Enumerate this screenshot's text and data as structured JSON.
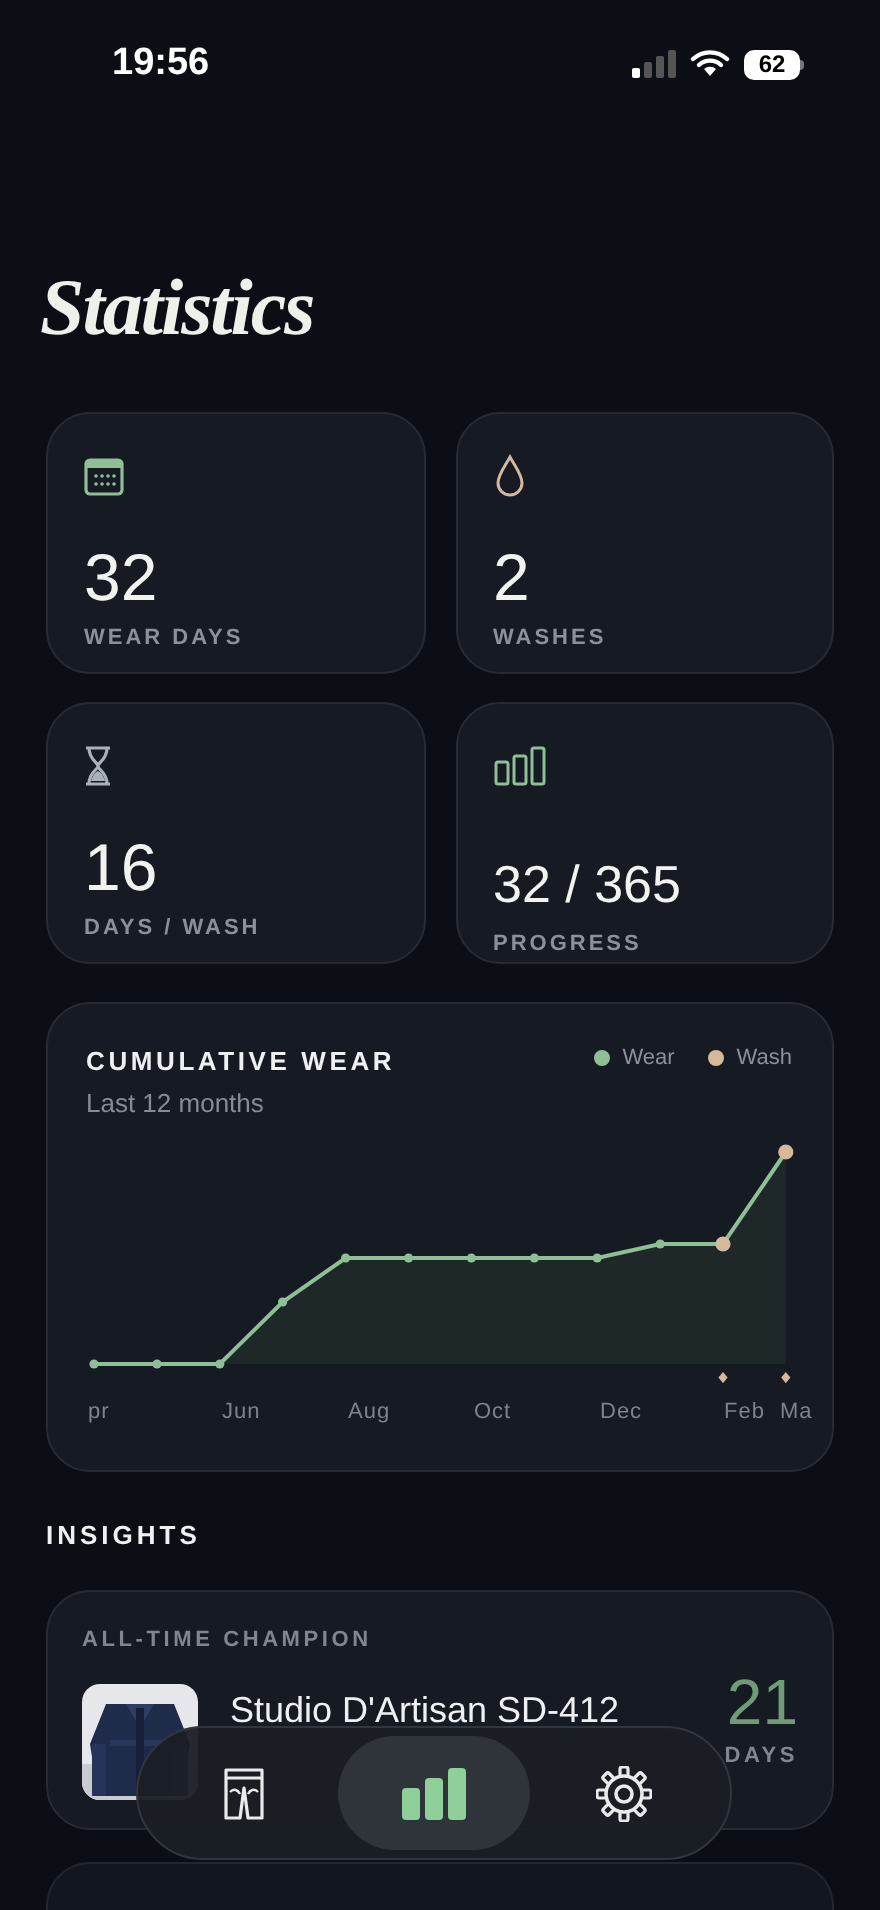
{
  "status_bar": {
    "time": "19:56",
    "battery": "62"
  },
  "title": "Statistics",
  "stats": [
    {
      "kind": "calendar",
      "value": "32",
      "label": "WEAR DAYS"
    },
    {
      "kind": "drop",
      "value": "2",
      "label": "WASHES"
    },
    {
      "kind": "hourglass",
      "value": "16",
      "label": "DAYS / WASH"
    },
    {
      "kind": "bars",
      "value": "32 / 365",
      "label": "PROGRESS"
    }
  ],
  "chart": {
    "title": "CUMULATIVE WEAR",
    "subtitle": "Last 12 months",
    "legend": [
      {
        "name": "Wear",
        "color": "#8fbf94"
      },
      {
        "name": "Wash",
        "color": "#d6b89a"
      }
    ],
    "x_labels": [
      "pr",
      "Jun",
      "Aug",
      "Oct",
      "Dec",
      "Feb",
      "Ma"
    ]
  },
  "insights": {
    "heading": "INSIGHTS",
    "champion": {
      "label": "ALL-TIME CHAMPION",
      "name": "Studio D'Artisan SD-412",
      "count": "21",
      "unit": "DAYS"
    }
  },
  "tab_bar": [
    {
      "kind": "jeans",
      "selected": false
    },
    {
      "kind": "stats",
      "selected": true
    },
    {
      "kind": "settings",
      "selected": false
    }
  ]
}
